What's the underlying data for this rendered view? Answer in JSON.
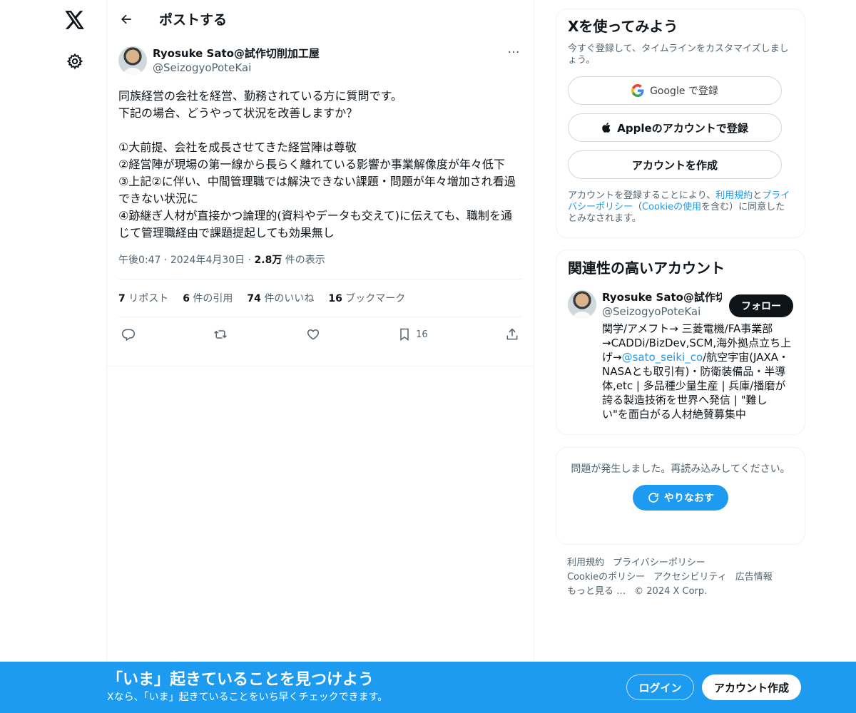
{
  "colors": {
    "accent": "#1d9bf0",
    "text": "#0f1419",
    "muted": "#536471",
    "border": "#eff3f4"
  },
  "icons": [
    "x-logo-icon",
    "gear-icon",
    "back-arrow-icon",
    "more-icon",
    "reply-icon",
    "repost-icon",
    "like-icon",
    "bookmark-icon",
    "share-icon",
    "google-icon",
    "apple-icon",
    "refresh-icon"
  ],
  "header": {
    "title": "ポストする"
  },
  "tweet": {
    "display_name": "Ryosuke Sato@試作切削加工屋",
    "handle": "@SeizogyoPoteKai",
    "more": "···",
    "text": "同族経営の会社を経営、勤務されている方に質問です。\n下記の場合、どうやって状況を改善しますか？\n\n①大前提、会社を成長させてきた経営陣は尊敬\n②経営陣が現場の第一線から長らく離れている影響か事業解像度が年々低下\n③上記②に伴い、中間管理職では解決できない課題・問題が年々増加され看過できない状況に\n④跡継ぎ人材が直接かつ論理的(資料やデータも交えて)に伝えても、職制を通じて管理職経由で課題提起しても効果無し",
    "time": "午後0:47",
    "date": "2024年4月30日",
    "views_count": "2.8万",
    "views_label": "件の表示",
    "reposts_count": "7",
    "reposts_label": "リポスト",
    "quotes_count": "6",
    "quotes_label": "件の引用",
    "likes_count": "74",
    "likes_label": "件のいいね",
    "bookmarks_count": "16",
    "bookmarks_label": "ブックマーク",
    "bookmark_action_count": "16"
  },
  "signup": {
    "title": "Xを使ってみよう",
    "subtitle": "今すぐ登録して、タイムラインをカスタマイズしましょう。",
    "google_label": "Google で登録",
    "apple_label": "Appleのアカウントで登録",
    "create_label": "アカウントを作成",
    "terms_prefix": "アカウントを登録することにより、",
    "terms_link": "利用規約",
    "terms_and": "と",
    "privacy_link": "プライバシーポリシー",
    "terms_paren_open": "（",
    "cookie_link": "Cookieの使用",
    "terms_suffix": "を含む）に同意したとみなされます。"
  },
  "related": {
    "title": "関連性の高いアカウント",
    "name": "Ryosuke Sato@試作切削加工屋",
    "handle": "@SeizogyoPoteKai",
    "follow_label": "フォロー",
    "bio_before": "関学/アメフト→ 三菱電機/FA事業部→CADDi/BizDev,SCM,海外拠点立ち上げ→",
    "bio_link": "@sato_seiki_co",
    "bio_after": "/航空宇宙(JAXA・NASAとも取引有)・防衛装備品・半導体,etc | 多品種少量生産 | 兵庫/播磨が誇る製造技術を世界へ発信 | \"難しい\"を面白がる人材絶賛募集中"
  },
  "error": {
    "message": "問題が発生しました。再読み込みしてください。",
    "retry_label": "やりなおす"
  },
  "footer": {
    "terms": "利用規約",
    "privacy": "プライバシーポリシー",
    "cookie": "Cookieのポリシー",
    "accessibility": "アクセシビリティ",
    "ads": "広告情報",
    "more": "もっと見る …",
    "copyright": "© 2024 X Corp."
  },
  "banner": {
    "title": "「いま」起きていることを見つけよう",
    "subtitle": "Xなら、「いま」起きていることをいち早くチェックできます。",
    "login_label": "ログイン",
    "signup_label": "アカウント作成"
  }
}
